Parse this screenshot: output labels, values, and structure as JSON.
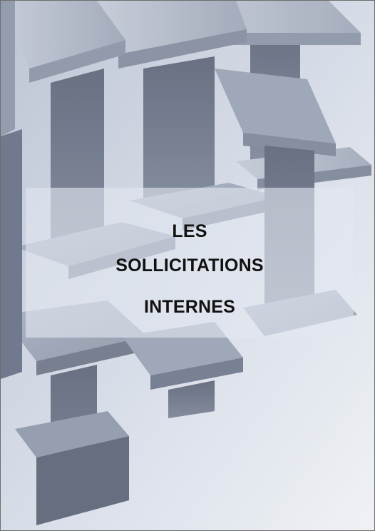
{
  "document": {
    "title_lines": [
      "LES",
      "SOLLICITATIONS",
      "INTERNES"
    ]
  },
  "cover": {
    "image": "steel-i-beams",
    "palette": {
      "background": "#dde3ec",
      "beam_light": "#a9b2c3",
      "beam_mid": "#7d879b",
      "beam_dark": "#4e5668",
      "panel": "#e2e7f0"
    }
  }
}
